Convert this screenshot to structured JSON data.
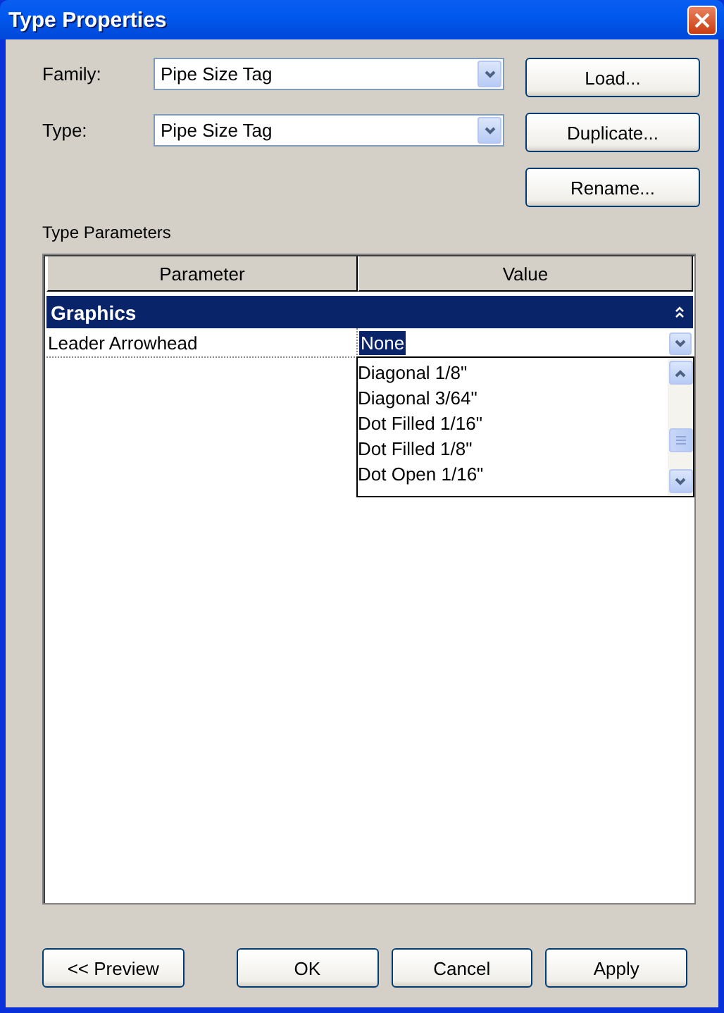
{
  "window": {
    "title": "Type Properties"
  },
  "fields": [
    {
      "label": "Family:",
      "value": "Pipe Size Tag"
    },
    {
      "label": "Type:",
      "value": "Pipe Size Tag"
    }
  ],
  "side_buttons": [
    "Load...",
    "Duplicate...",
    "Rename..."
  ],
  "section_label": "Type Parameters",
  "table": {
    "columns": [
      "Parameter",
      "Value"
    ],
    "groups": [
      {
        "name": "Graphics",
        "expanded": true,
        "rows": [
          {
            "parameter": "Leader Arrowhead",
            "value": "None",
            "selected": true,
            "dropdown_open": true,
            "options": [
              "Diagonal 1/8\"",
              "Diagonal 3/64\"",
              "Dot Filled 1/16\"",
              "Dot Filled 1/8\"",
              "Dot Open 1/16\""
            ]
          }
        ]
      }
    ]
  },
  "buttons": [
    "<< Preview",
    "OK",
    "Cancel",
    "Apply"
  ]
}
